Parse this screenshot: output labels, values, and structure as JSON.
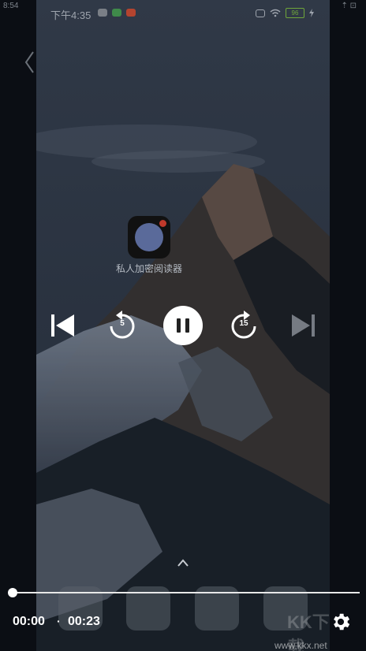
{
  "outer_status": {
    "time": "8:54",
    "right_text": "⇡ ⊡"
  },
  "inner_status": {
    "time": "下午4:35",
    "battery": "96"
  },
  "app": {
    "label": "私人加密阅读器"
  },
  "player": {
    "rewind_seconds": "5",
    "forward_seconds": "15",
    "current_time": "00:00",
    "separator": "·",
    "duration": "00:23",
    "progress_fraction": 0.0
  },
  "watermark": {
    "big": "KK下载",
    "small": "www.kkx.net"
  },
  "icons": {
    "back": "chevron-left-icon",
    "previous": "skip-previous-icon",
    "rewind": "replay-5-icon",
    "pause": "pause-icon",
    "forward": "forward-15-icon",
    "next": "skip-next-icon",
    "settings": "gear-icon",
    "swipe_up": "chevron-up-icon"
  },
  "colors": {
    "accent": "#ffffff",
    "background": "#0b0e14"
  }
}
